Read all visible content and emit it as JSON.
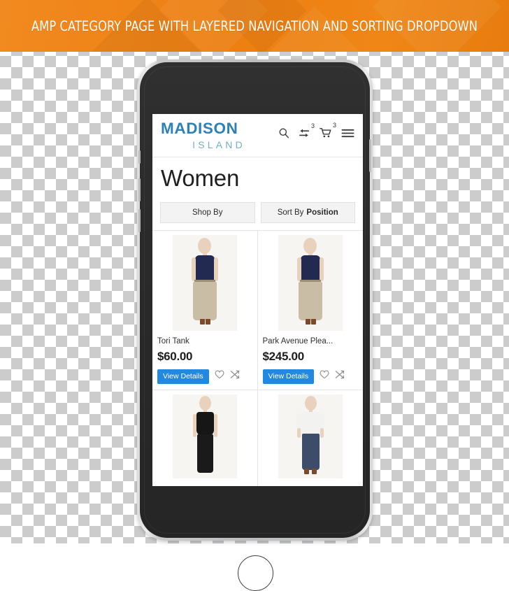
{
  "banner": {
    "title": "AMP CATEGORY PAGE WITH LAYERED NAVIGATION AND SORTING DROPDOWN",
    "background_color": "#ee8014",
    "text_color": "#ffffff"
  },
  "device": {
    "type": "smartphone-mockup",
    "frame_color": "#2a2a2a",
    "bezel_color": "#c9cacb"
  },
  "store": {
    "logo": {
      "line1": "MADISON",
      "line2": "ISLAND",
      "line1_color": "#2d82b5",
      "line2_color": "#73aecd"
    },
    "header_icons": [
      {
        "name": "search-icon",
        "badge": ""
      },
      {
        "name": "compare-icon",
        "badge": "3"
      },
      {
        "name": "cart-icon",
        "badge": "3"
      },
      {
        "name": "menu-icon",
        "badge": ""
      }
    ]
  },
  "category": {
    "title": "Women"
  },
  "toolbar": {
    "shop_by_label": "Shop By",
    "sort_by_label": "Sort By",
    "sort_by_value": "Position"
  },
  "products": [
    {
      "name": "Tori Tank",
      "price": "$60.00",
      "button_label": "View Details",
      "wishlist_icon": "heart-icon",
      "compare_icon": "compare-arrows-icon",
      "image_alt": "navy-tank-beige-maxi-skirt"
    },
    {
      "name": "Park Avenue Plea...",
      "price": "$245.00",
      "button_label": "View Details",
      "wishlist_icon": "heart-icon",
      "compare_icon": "compare-arrows-icon",
      "image_alt": "navy-tank-beige-pleated-skirt"
    },
    {
      "name": "",
      "price": "",
      "button_label": "",
      "wishlist_icon": "",
      "compare_icon": "",
      "image_alt": "black-cami-black-trousers"
    },
    {
      "name": "",
      "price": "",
      "button_label": "",
      "wishlist_icon": "",
      "compare_icon": "",
      "image_alt": "white-tee-blue-jeans"
    }
  ],
  "colors": {
    "accent_button": "#2388e0",
    "toolbar_bg": "#f3f3f3",
    "border": "#e4e4e4"
  }
}
